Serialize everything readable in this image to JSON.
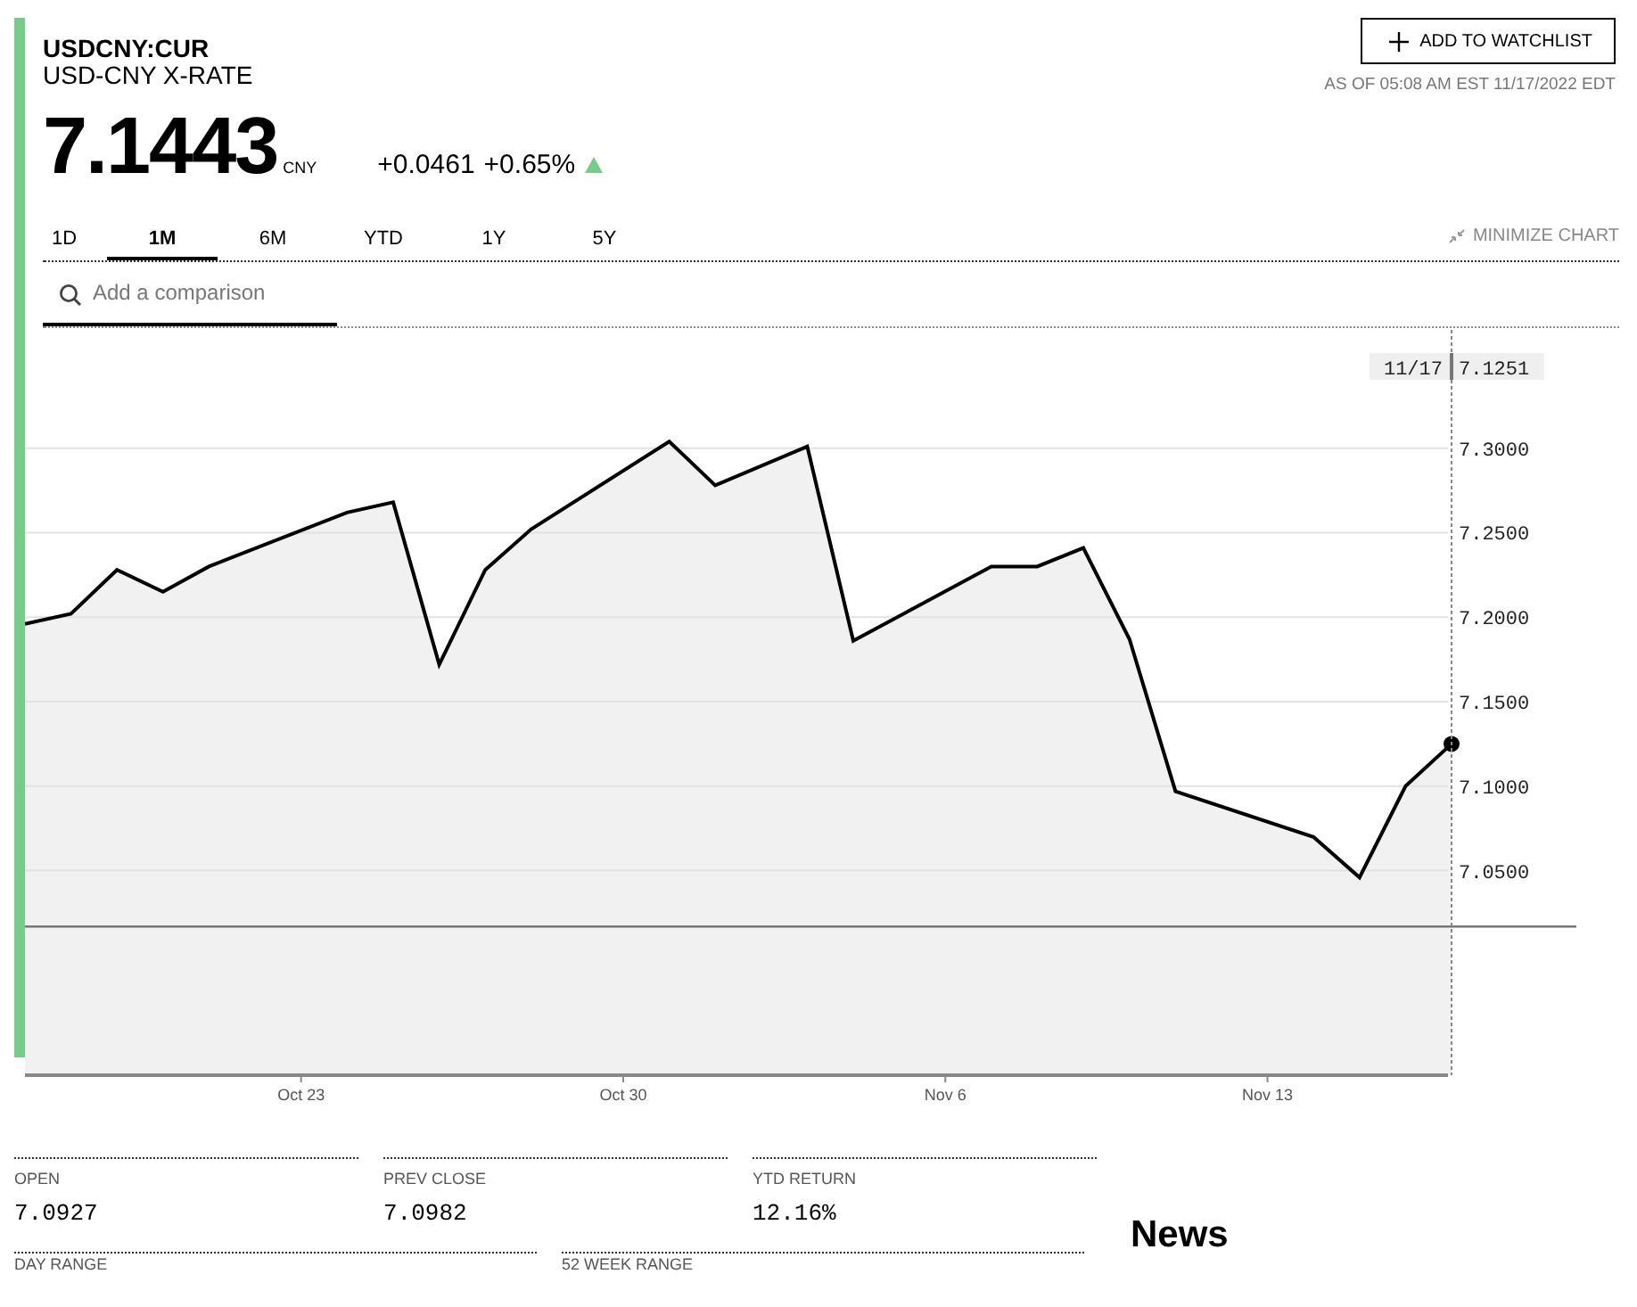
{
  "quote": {
    "ticker": "USDCNY:CUR",
    "name": "USD-CNY X-RATE",
    "price": "7.1443",
    "currency": "CNY",
    "change": "+0.0461",
    "change_percent": "+0.65%",
    "rising": true
  },
  "watchlist_button": {
    "label": "ADD TO WATCHLIST"
  },
  "as_of": "AS OF 05:08 AM EST 11/17/2022 EDT",
  "tabs": [
    {
      "label": "1D",
      "selected": false
    },
    {
      "label": "1M",
      "selected": true
    },
    {
      "label": "6M",
      "selected": false
    },
    {
      "label": "YTD",
      "selected": false
    },
    {
      "label": "1Y",
      "selected": false
    },
    {
      "label": "5Y",
      "selected": false
    }
  ],
  "minimize_chart": "MINIMIZE CHART",
  "search": {
    "placeholder": "Add a comparison"
  },
  "chart": {
    "tooltip_date": "11/17",
    "tooltip_value": "7.1251",
    "chart_data": {
      "type": "area",
      "categories": [
        null,
        null,
        null,
        null,
        null,
        null,
        "Oct 23",
        null,
        null,
        null,
        null,
        null,
        null,
        "Oct 30",
        null,
        null,
        null,
        null,
        null,
        null,
        "Nov 6",
        null,
        null,
        null,
        null,
        null,
        null,
        "Nov 13",
        null,
        null,
        null,
        null
      ],
      "series": [
        {
          "color": "#000000",
          "values": [
            7.196,
            7.202,
            7.228,
            7.215,
            7.23,
            null,
            null,
            7.262,
            7.268,
            7.172,
            7.228,
            7.252,
            null,
            null,
            7.304,
            7.278,
            null,
            7.301,
            7.186,
            null,
            null,
            7.23,
            7.23,
            7.241,
            7.187,
            7.097,
            null,
            null,
            7.07,
            7.046,
            7.1,
            7.125
          ]
        }
      ],
      "ylim": [
        6.929,
        7.37
      ],
      "grid": true,
      "ref_lines": [
        {
          "axis": "y",
          "value": 7.017
        }
      ],
      "yticks": [
        {
          "value": 7.05,
          "label": "7.0500"
        },
        {
          "value": 7.1,
          "label": "7.1000"
        },
        {
          "value": 7.15,
          "label": "7.1500"
        },
        {
          "value": 7.2,
          "label": "7.2000"
        },
        {
          "value": 7.25,
          "label": "7.2500"
        },
        {
          "value": 7.3,
          "label": "7.3000"
        }
      ]
    }
  },
  "stats": [
    {
      "label": "OPEN",
      "value": "7.0927"
    },
    {
      "label": "PREV CLOSE",
      "value": "7.0982"
    },
    {
      "label": "YTD RETURN",
      "value": "12.16%"
    }
  ],
  "stats_row_2": [
    {
      "label": "DAY RANGE"
    },
    {
      "label": "52 WEEK RANGE"
    }
  ],
  "news_heading": "News"
}
